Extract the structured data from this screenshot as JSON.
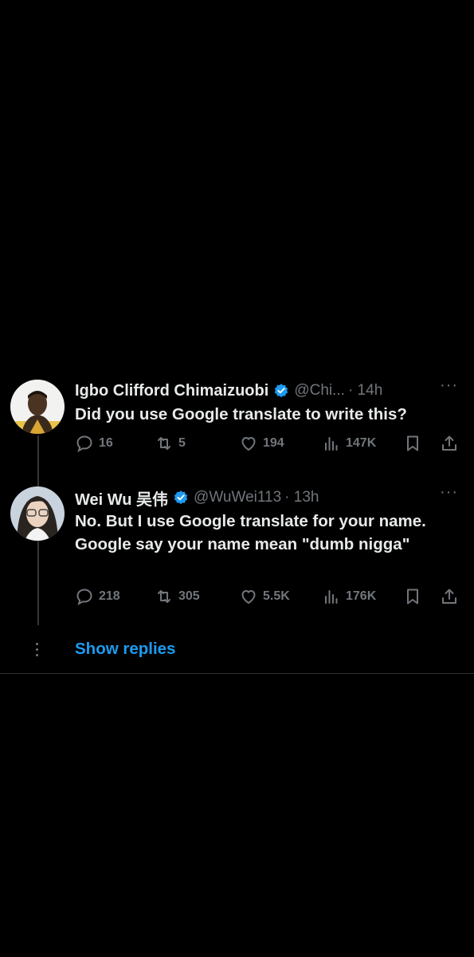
{
  "tweets": [
    {
      "name": "Igbo Clifford Chimaizuobi",
      "handle": "@Chi...",
      "time": "· 14h",
      "text": "Did you use Google translate to write this?",
      "replies": "16",
      "retweets": "5",
      "likes": "194",
      "views": "147K"
    },
    {
      "name": "Wei Wu 吴伟",
      "handle": "@WuWei113",
      "time": "· 13h",
      "text": "No. But I use Google translate for your name. Google say your name mean \"dumb nigga\"",
      "replies": "218",
      "retweets": "305",
      "likes": "5.5K",
      "views": "176K"
    }
  ],
  "more_label": "···",
  "show_replies": "Show replies",
  "colors": {
    "background": "#000000",
    "accent": "#1d9bf0",
    "muted": "#71767b",
    "text": "#e7e9ea"
  }
}
